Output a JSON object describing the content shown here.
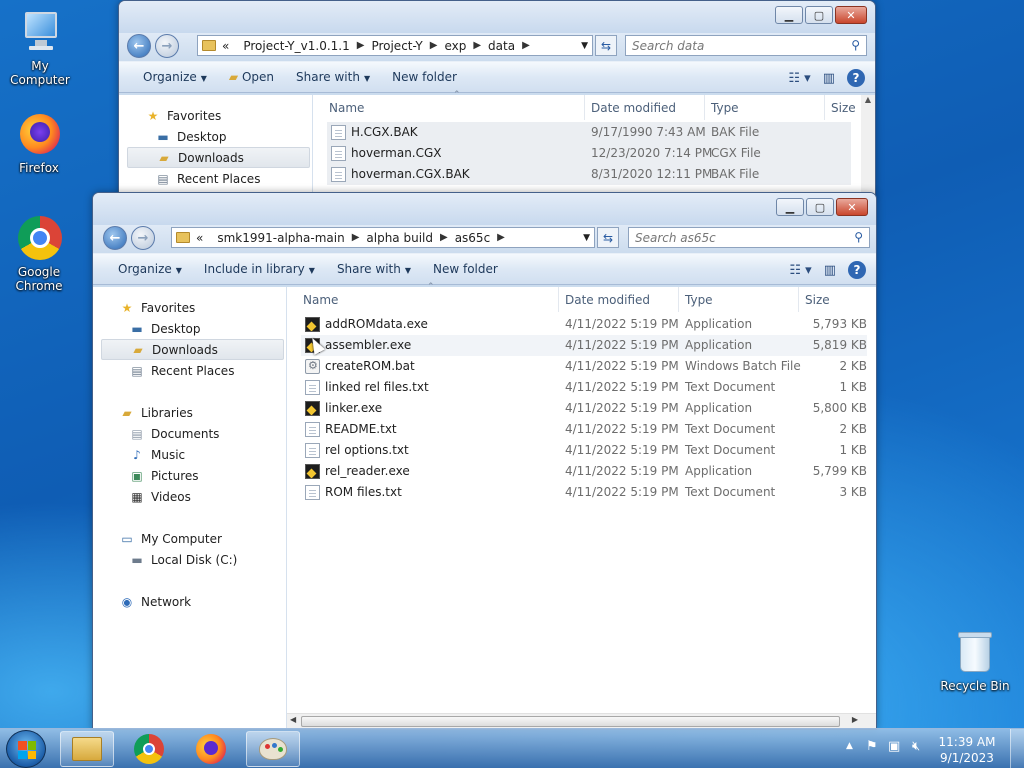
{
  "desktop": {
    "icons": [
      {
        "label": "My Computer"
      },
      {
        "label": "Firefox"
      },
      {
        "label": "Google Chrome"
      },
      {
        "label": "Recycle Bin"
      }
    ]
  },
  "back_window": {
    "breadcrumb": [
      "«",
      "Project-Y_v1.0.1.1",
      "Project-Y",
      "exp",
      "data"
    ],
    "search_placeholder": "Search data",
    "toolbar": {
      "organize": "Organize",
      "open": "Open",
      "share_with": "Share with",
      "new_folder": "New folder"
    },
    "nav": {
      "favorites": "Favorites",
      "desktop": "Desktop",
      "downloads": "Downloads",
      "recent_places": "Recent Places"
    },
    "columns": {
      "name": "Name",
      "date_modified": "Date modified",
      "type": "Type",
      "size": "Size"
    },
    "files": [
      {
        "name": "H.CGX.BAK",
        "date": "9/17/1990 7:43 AM",
        "type": "BAK File"
      },
      {
        "name": "hoverman.CGX",
        "date": "12/23/2020 7:14 PM",
        "type": "CGX File"
      },
      {
        "name": "hoverman.CGX.BAK",
        "date": "8/31/2020 12:11 PM",
        "type": "BAK File"
      }
    ]
  },
  "front_window": {
    "breadcrumb": [
      "«",
      "smk1991-alpha-main",
      "alpha build",
      "as65c"
    ],
    "search_placeholder": "Search as65c",
    "toolbar": {
      "organize": "Organize",
      "include_in_library": "Include in library",
      "share_with": "Share with",
      "new_folder": "New folder"
    },
    "nav": {
      "favorites": "Favorites",
      "desktop": "Desktop",
      "downloads": "Downloads",
      "recent_places": "Recent Places",
      "libraries": "Libraries",
      "documents": "Documents",
      "music": "Music",
      "pictures": "Pictures",
      "videos": "Videos",
      "my_computer": "My Computer",
      "local_disk": "Local Disk (C:)",
      "network": "Network"
    },
    "columns": {
      "name": "Name",
      "date_modified": "Date modified",
      "type": "Type",
      "size": "Size"
    },
    "files": [
      {
        "name": "addROMdata.exe",
        "date": "4/11/2022 5:19 PM",
        "type": "Application",
        "size": "5,793 KB",
        "icon": "app"
      },
      {
        "name": "assembler.exe",
        "date": "4/11/2022 5:19 PM",
        "type": "Application",
        "size": "5,819 KB",
        "icon": "app"
      },
      {
        "name": "createROM.bat",
        "date": "4/11/2022 5:19 PM",
        "type": "Windows Batch File",
        "size": "2 KB",
        "icon": "bat"
      },
      {
        "name": "linked rel files.txt",
        "date": "4/11/2022 5:19 PM",
        "type": "Text Document",
        "size": "1 KB",
        "icon": "txt"
      },
      {
        "name": "linker.exe",
        "date": "4/11/2022 5:19 PM",
        "type": "Application",
        "size": "5,800 KB",
        "icon": "app"
      },
      {
        "name": "README.txt",
        "date": "4/11/2022 5:19 PM",
        "type": "Text Document",
        "size": "2 KB",
        "icon": "txt"
      },
      {
        "name": "rel options.txt",
        "date": "4/11/2022 5:19 PM",
        "type": "Text Document",
        "size": "1 KB",
        "icon": "txt"
      },
      {
        "name": "rel_reader.exe",
        "date": "4/11/2022 5:19 PM",
        "type": "Application",
        "size": "5,799 KB",
        "icon": "app"
      },
      {
        "name": "ROM files.txt",
        "date": "4/11/2022 5:19 PM",
        "type": "Text Document",
        "size": "3 KB",
        "icon": "txt"
      }
    ]
  },
  "taskbar": {
    "time": "11:39 AM",
    "date": "9/1/2023"
  }
}
